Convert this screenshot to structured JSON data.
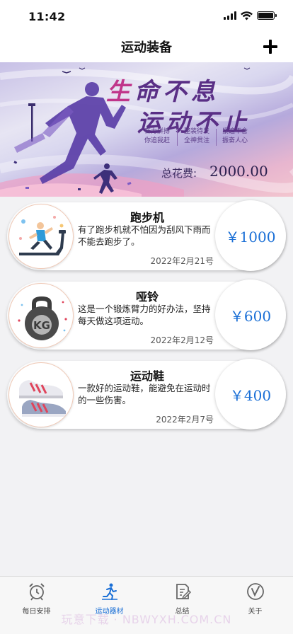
{
  "status": {
    "time": "11:42"
  },
  "nav": {
    "title": "运动装备"
  },
  "banner": {
    "slogan_first_char": "生",
    "slogan_line1_rest": "命不息",
    "slogan_line2": "运动不止",
    "taglines": [
      [
        "奋力拼搏",
        "你追我赶"
      ],
      [
        "整装待发",
        "全神贯注"
      ],
      [
        "紧追不舍",
        "振奋人心"
      ]
    ],
    "total_label": "总花费:",
    "total_value": "2000.00"
  },
  "items": [
    {
      "name": "跑步机",
      "desc": "有了跑步机就不怕因为刮风下雨而不能去跑步了。",
      "date": "2022年2月21号",
      "price": "￥1000",
      "icon": "treadmill-icon"
    },
    {
      "name": "哑铃",
      "desc": "这是一个锻炼臂力的好办法，坚持每天做这项运动。",
      "date": "2022年2月12号",
      "price": "￥600",
      "icon": "kettlebell-icon"
    },
    {
      "name": "运动鞋",
      "desc": "一款好的运动鞋，能避免在运动时的一些伤害。",
      "date": "2022年2月7号",
      "price": "￥400",
      "icon": "sneakers-icon"
    }
  ],
  "tabs": [
    {
      "label": "每日安排",
      "icon": "alarm-clock-icon",
      "active": false
    },
    {
      "label": "运动器材",
      "icon": "runner-icon",
      "active": true
    },
    {
      "label": "总结",
      "icon": "edit-note-icon",
      "active": false
    },
    {
      "label": "关于",
      "icon": "check-circle-icon",
      "active": false
    }
  ],
  "colors": {
    "accent": "#1a6fd6",
    "slogan": "#5a2f86",
    "slogan_highlight": "#c0358a"
  },
  "watermark": "玩意下载 · NBWYXH.COM.CN"
}
